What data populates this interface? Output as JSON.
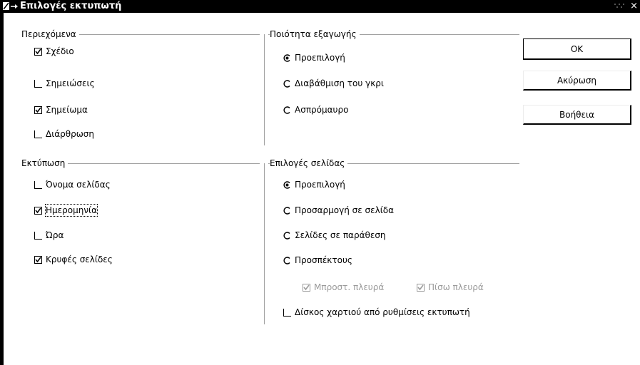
{
  "window": {
    "title": "Επιλογές εκτυπωτή",
    "close_glyph": "×"
  },
  "contents": {
    "label": "Περιεχόμενα",
    "items": [
      {
        "label": "Σχέδιο",
        "checked": true
      },
      {
        "label": "Σημειώσεις",
        "checked": false
      },
      {
        "label": "Σημείωμα",
        "checked": true
      },
      {
        "label": "Διάρθρωση",
        "checked": false
      }
    ]
  },
  "print_section": {
    "label": "Εκτύπωση",
    "items": [
      {
        "label": "Όνομα σελίδας",
        "checked": false
      },
      {
        "label": "Ημερομηνία",
        "checked": true
      },
      {
        "label": "Ώρα",
        "checked": false
      },
      {
        "label": "Κρυφές σελίδες",
        "checked": true
      }
    ]
  },
  "output_quality": {
    "label": "Ποιότητα εξαγωγής",
    "items": [
      {
        "label": "Προεπιλογή",
        "selected": true
      },
      {
        "label": "Διαβάθμιση του γκρι",
        "selected": false
      },
      {
        "label": "Ασπρόμαυρο",
        "selected": false
      }
    ]
  },
  "page_options": {
    "label": "Επιλογές σελίδας",
    "items": [
      {
        "label": "Προεπιλογή",
        "selected": true
      },
      {
        "label": "Προσαρμογή σε σελίδα",
        "selected": false
      },
      {
        "label": "Σελίδες σε παράθεση",
        "selected": false
      },
      {
        "label": "Προσπέκτους",
        "selected": false
      }
    ],
    "sub_options": [
      {
        "label": "Μπροστ. πλευρά",
        "checked": true,
        "disabled": true
      },
      {
        "label": "Πίσω πλευρά",
        "checked": true,
        "disabled": true
      }
    ],
    "paper_tray": {
      "label": "Δίσκος χαρτιού από ρυθμίσεις εκτυπωτή",
      "checked": false
    }
  },
  "buttons": {
    "ok": "OK",
    "cancel": "Ακύρωση",
    "help": "Βοήθεια"
  }
}
